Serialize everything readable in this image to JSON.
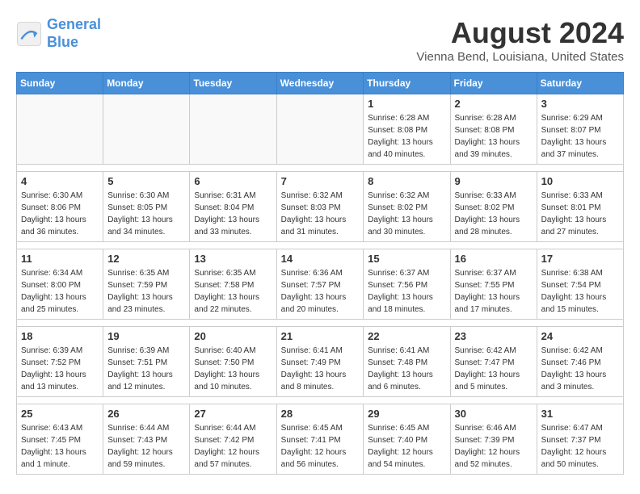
{
  "header": {
    "logo_line1": "General",
    "logo_line2": "Blue",
    "month": "August 2024",
    "location": "Vienna Bend, Louisiana, United States"
  },
  "weekdays": [
    "Sunday",
    "Monday",
    "Tuesday",
    "Wednesday",
    "Thursday",
    "Friday",
    "Saturday"
  ],
  "weeks": [
    [
      {
        "day": "",
        "info": ""
      },
      {
        "day": "",
        "info": ""
      },
      {
        "day": "",
        "info": ""
      },
      {
        "day": "",
        "info": ""
      },
      {
        "day": "1",
        "sunrise": "6:28 AM",
        "sunset": "8:08 PM",
        "daylight": "13 hours and 40 minutes."
      },
      {
        "day": "2",
        "sunrise": "6:28 AM",
        "sunset": "8:08 PM",
        "daylight": "13 hours and 39 minutes."
      },
      {
        "day": "3",
        "sunrise": "6:29 AM",
        "sunset": "8:07 PM",
        "daylight": "13 hours and 37 minutes."
      }
    ],
    [
      {
        "day": "4",
        "sunrise": "6:30 AM",
        "sunset": "8:06 PM",
        "daylight": "13 hours and 36 minutes."
      },
      {
        "day": "5",
        "sunrise": "6:30 AM",
        "sunset": "8:05 PM",
        "daylight": "13 hours and 34 minutes."
      },
      {
        "day": "6",
        "sunrise": "6:31 AM",
        "sunset": "8:04 PM",
        "daylight": "13 hours and 33 minutes."
      },
      {
        "day": "7",
        "sunrise": "6:32 AM",
        "sunset": "8:03 PM",
        "daylight": "13 hours and 31 minutes."
      },
      {
        "day": "8",
        "sunrise": "6:32 AM",
        "sunset": "8:02 PM",
        "daylight": "13 hours and 30 minutes."
      },
      {
        "day": "9",
        "sunrise": "6:33 AM",
        "sunset": "8:02 PM",
        "daylight": "13 hours and 28 minutes."
      },
      {
        "day": "10",
        "sunrise": "6:33 AM",
        "sunset": "8:01 PM",
        "daylight": "13 hours and 27 minutes."
      }
    ],
    [
      {
        "day": "11",
        "sunrise": "6:34 AM",
        "sunset": "8:00 PM",
        "daylight": "13 hours and 25 minutes."
      },
      {
        "day": "12",
        "sunrise": "6:35 AM",
        "sunset": "7:59 PM",
        "daylight": "13 hours and 23 minutes."
      },
      {
        "day": "13",
        "sunrise": "6:35 AM",
        "sunset": "7:58 PM",
        "daylight": "13 hours and 22 minutes."
      },
      {
        "day": "14",
        "sunrise": "6:36 AM",
        "sunset": "7:57 PM",
        "daylight": "13 hours and 20 minutes."
      },
      {
        "day": "15",
        "sunrise": "6:37 AM",
        "sunset": "7:56 PM",
        "daylight": "13 hours and 18 minutes."
      },
      {
        "day": "16",
        "sunrise": "6:37 AM",
        "sunset": "7:55 PM",
        "daylight": "13 hours and 17 minutes."
      },
      {
        "day": "17",
        "sunrise": "6:38 AM",
        "sunset": "7:54 PM",
        "daylight": "13 hours and 15 minutes."
      }
    ],
    [
      {
        "day": "18",
        "sunrise": "6:39 AM",
        "sunset": "7:52 PM",
        "daylight": "13 hours and 13 minutes."
      },
      {
        "day": "19",
        "sunrise": "6:39 AM",
        "sunset": "7:51 PM",
        "daylight": "13 hours and 12 minutes."
      },
      {
        "day": "20",
        "sunrise": "6:40 AM",
        "sunset": "7:50 PM",
        "daylight": "13 hours and 10 minutes."
      },
      {
        "day": "21",
        "sunrise": "6:41 AM",
        "sunset": "7:49 PM",
        "daylight": "13 hours and 8 minutes."
      },
      {
        "day": "22",
        "sunrise": "6:41 AM",
        "sunset": "7:48 PM",
        "daylight": "13 hours and 6 minutes."
      },
      {
        "day": "23",
        "sunrise": "6:42 AM",
        "sunset": "7:47 PM",
        "daylight": "13 hours and 5 minutes."
      },
      {
        "day": "24",
        "sunrise": "6:42 AM",
        "sunset": "7:46 PM",
        "daylight": "13 hours and 3 minutes."
      }
    ],
    [
      {
        "day": "25",
        "sunrise": "6:43 AM",
        "sunset": "7:45 PM",
        "daylight": "13 hours and 1 minute."
      },
      {
        "day": "26",
        "sunrise": "6:44 AM",
        "sunset": "7:43 PM",
        "daylight": "12 hours and 59 minutes."
      },
      {
        "day": "27",
        "sunrise": "6:44 AM",
        "sunset": "7:42 PM",
        "daylight": "12 hours and 57 minutes."
      },
      {
        "day": "28",
        "sunrise": "6:45 AM",
        "sunset": "7:41 PM",
        "daylight": "12 hours and 56 minutes."
      },
      {
        "day": "29",
        "sunrise": "6:45 AM",
        "sunset": "7:40 PM",
        "daylight": "12 hours and 54 minutes."
      },
      {
        "day": "30",
        "sunrise": "6:46 AM",
        "sunset": "7:39 PM",
        "daylight": "12 hours and 52 minutes."
      },
      {
        "day": "31",
        "sunrise": "6:47 AM",
        "sunset": "7:37 PM",
        "daylight": "12 hours and 50 minutes."
      }
    ]
  ]
}
